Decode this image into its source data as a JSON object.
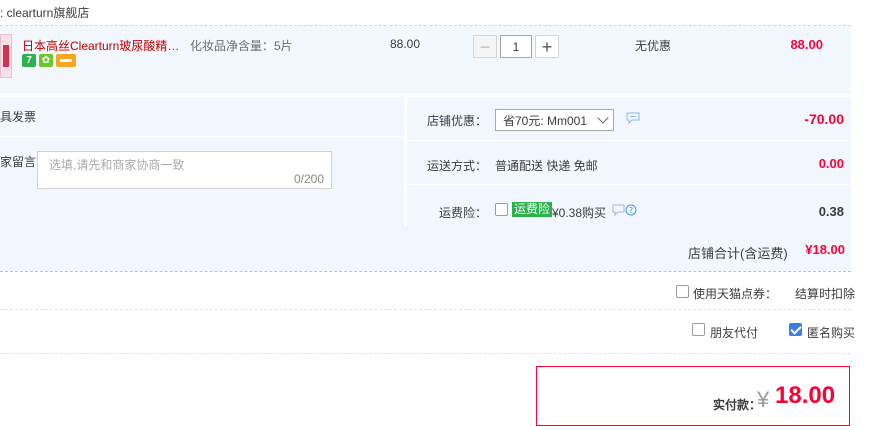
{
  "shop": {
    "title": ": clearturn旗舰店"
  },
  "item": {
    "name": "日本高丝Clearturn玻尿酸精华...",
    "badge_seven": "7",
    "attr": "化妆品净含量：5片",
    "price": "88.00",
    "quantity": "1",
    "minus": "−",
    "plus": "+",
    "promo": "无优惠",
    "total": "88.00"
  },
  "invoice": {
    "label": "具发票"
  },
  "message": {
    "label": "家留言：",
    "placeholder": "选填,请先和商家协商一致",
    "count": "0/200"
  },
  "coupon": {
    "label": "店铺优惠：",
    "selected": "省70元: Mm001",
    "value": "-70.00"
  },
  "shipping": {
    "label": "运送方式：",
    "method": "普通配送 快递 免邮",
    "price": "0.00"
  },
  "insurance": {
    "label": "运费险：",
    "tag": "运费险",
    "price": "¥0.38购买",
    "value": "0.38"
  },
  "subtotal": {
    "label": "店铺合计(含运费)",
    "value": "¥18.00"
  },
  "tmall_points": {
    "label": "使用天猫点券：",
    "value": "结算时扣除"
  },
  "options": {
    "friend_pay": "朋友代付",
    "anonymous": "匿名购买"
  },
  "pay": {
    "label": "实付款：",
    "currency": "¥",
    "amount": "18.00"
  },
  "colors": {
    "accent": "#ff0036",
    "panel": "#f2f7ff",
    "checkbox_checked": "#3d7ee6",
    "insurance_tag": "#2bb24c"
  }
}
